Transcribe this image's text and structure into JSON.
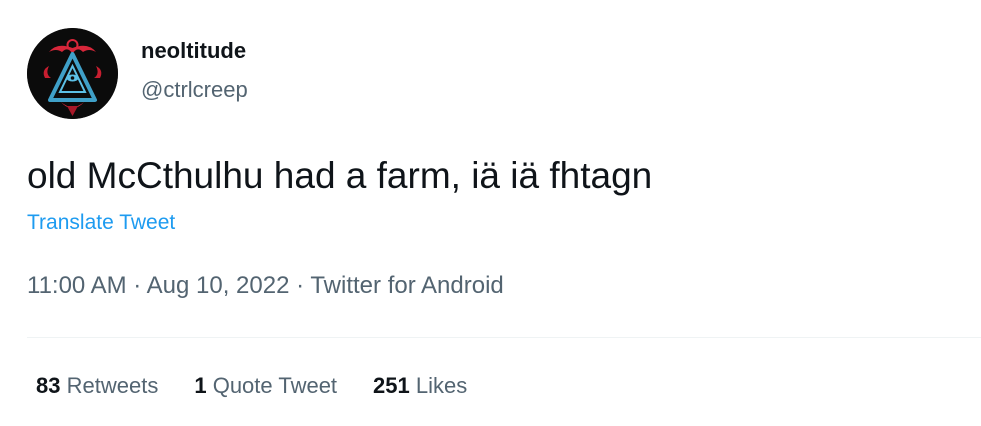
{
  "user": {
    "display_name": "neoltitude",
    "handle": "@ctrlcreep",
    "avatar_icon": "occult-triangle-sigil-icon"
  },
  "tweet": {
    "text": "old McCthulhu had a farm, iä iä fhtagn",
    "translate_label": "Translate Tweet"
  },
  "meta": {
    "time": "11:00 AM",
    "separator": "·",
    "date": "Aug 10, 2022",
    "source": "Twitter for Android"
  },
  "stats": {
    "retweets_count": "83",
    "retweets_label": "Retweets",
    "quotes_count": "1",
    "quotes_label": "Quote Tweet",
    "likes_count": "251",
    "likes_label": "Likes"
  },
  "colors": {
    "text": "#0f1419",
    "secondary": "#536471",
    "link": "#1d9bf0",
    "divider": "#eff3f4"
  }
}
